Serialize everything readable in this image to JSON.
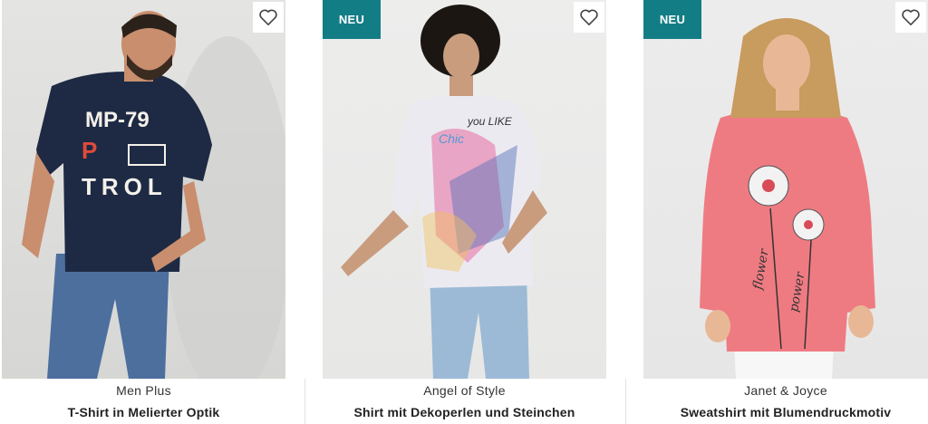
{
  "products": [
    {
      "brand": "Men Plus",
      "title": "T-Shirt in Melierter Optik",
      "badge": "",
      "shirt_print": [
        "MP-79",
        "P",
        "TROL"
      ]
    },
    {
      "brand": "Angel of Style",
      "title": "Shirt mit Dekoperlen und Steinchen",
      "badge": "NEU",
      "shirt_print": [
        "Chic",
        "you LIKE"
      ]
    },
    {
      "brand": "Janet & Joyce",
      "title": "Sweatshirt mit Blumendruckmotiv",
      "badge": "NEU",
      "shirt_print": [
        "flower",
        "power"
      ]
    }
  ],
  "colors": {
    "badge_bg": "#137d86",
    "navy_shirt": "#1e2a44",
    "coral_shirt": "#ef7b82",
    "denim": "#4c6f9e"
  },
  "icons": {
    "wishlist": "heart-outline-icon"
  }
}
